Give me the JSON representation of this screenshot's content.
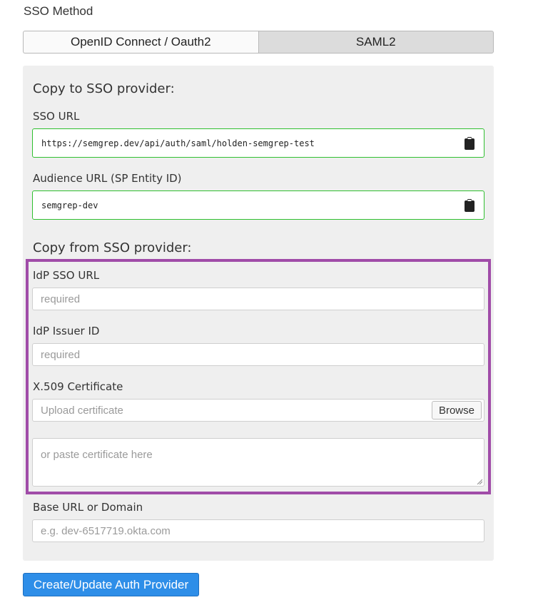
{
  "sso_method": {
    "title": "SSO Method",
    "options": [
      "OpenID Connect / Oauth2",
      "SAML2"
    ],
    "selected": "SAML2"
  },
  "copy_to": {
    "heading": "Copy to SSO provider:",
    "sso_url": {
      "label": "SSO URL",
      "value": "https://semgrep.dev/api/auth/saml/holden-semgrep-test"
    },
    "audience_url": {
      "label": "Audience URL (SP Entity ID)",
      "value": "semgrep-dev"
    }
  },
  "copy_from": {
    "heading": "Copy from SSO provider:",
    "idp_sso_url": {
      "label": "IdP SSO URL",
      "placeholder": "required"
    },
    "idp_issuer_id": {
      "label": "IdP Issuer ID",
      "placeholder": "required"
    },
    "certificate": {
      "label": "X.509 Certificate",
      "upload_placeholder": "Upload certificate",
      "browse_label": "Browse",
      "paste_placeholder": "or paste certificate here"
    }
  },
  "base_url": {
    "label": "Base URL or Domain",
    "placeholder": "e.g. dev-6517719.okta.com"
  },
  "submit_label": "Create/Update Auth Provider",
  "colors": {
    "highlight": "#a04ca8",
    "valid_border": "#2fbf2f",
    "primary": "#2e8ee8"
  }
}
